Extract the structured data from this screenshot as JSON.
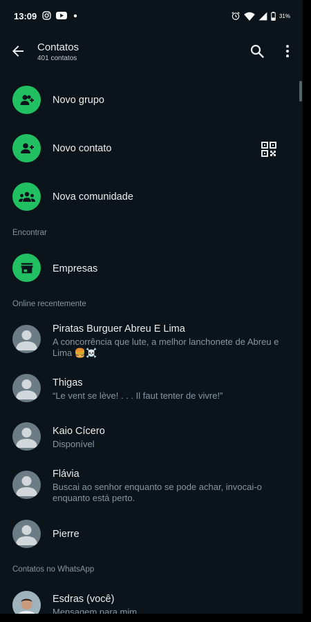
{
  "status_bar": {
    "time": "13:09",
    "battery": "31%",
    "left_icons": [
      "instagram-icon",
      "youtube-icon",
      "dot-icon"
    ],
    "right_icons": [
      "alarm-icon",
      "wifi-icon",
      "signal-icon",
      "battery-icon"
    ]
  },
  "app_bar": {
    "title": "Contatos",
    "subtitle": "401 contatos",
    "icons": [
      "back-arrow-icon",
      "search-icon",
      "more-vertical-icon"
    ]
  },
  "actions": [
    {
      "label": "Novo grupo",
      "icon": "group-add-icon"
    },
    {
      "label": "Novo contato",
      "icon": "person-add-icon",
      "trailing_icon": "qr-code-icon"
    },
    {
      "label": "Nova comunidade",
      "icon": "community-icon"
    }
  ],
  "sections": {
    "find": "Encontrar",
    "recent": "Online recentemente",
    "whatsapp": "Contatos no WhatsApp"
  },
  "find_items": [
    {
      "label": "Empresas",
      "icon": "store-icon"
    }
  ],
  "recent_contacts": [
    {
      "name": "Piratas Burguer Abreu E Lima",
      "status": "A concorrência que lute, a melhor lanchonete de Abreu e Lima 🍔☠️"
    },
    {
      "name": "Thigas",
      "status": "“Le vent se lève! . . . Il faut tenter de vivre!”"
    },
    {
      "name": "Kaio Cícero",
      "status": "Disponível"
    },
    {
      "name": "Flávia",
      "status": "Buscai ao senhor enquanto se pode achar, invocai-o enquanto está perto."
    },
    {
      "name": "Pierre",
      "status": ""
    }
  ],
  "whatsapp_contacts": [
    {
      "name": "Esdras (você)",
      "status": "Mensagem para mim"
    }
  ],
  "colors": {
    "background": "#0b141a",
    "accent_green": "#21c063",
    "primary_text": "#e9edef",
    "secondary_text": "#8696a0",
    "default_avatar": "#6b7c85"
  }
}
